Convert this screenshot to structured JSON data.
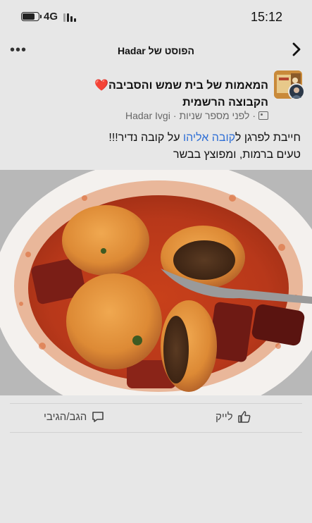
{
  "status_bar": {
    "network": "4G",
    "time": "15:12",
    "battery_level": 0.75
  },
  "header": {
    "title": "הפוסט של Hadar",
    "more_icon": "more-horizontal-icon",
    "back_icon": "chevron-right-icon"
  },
  "post": {
    "group_name": "המאמות של בית שמש והסביבה❤️הקבוצה הרשמית",
    "author": "Hadar Ivgi",
    "timestamp": "לפני מספר שניות",
    "privacy_icon": "group-icon",
    "text_before_link": "חייבת לפרגן ל",
    "link_text": "קובה אליהו",
    "text_after_link": " על קובה נדיר!!!",
    "text_line2": "טעים ברמות, ומפוצץ בבשר"
  },
  "actions": {
    "like_label": "לייק",
    "like_icon": "thumbs-up-icon",
    "comment_label": "הגב/הגיבי",
    "comment_icon": "comment-icon"
  }
}
